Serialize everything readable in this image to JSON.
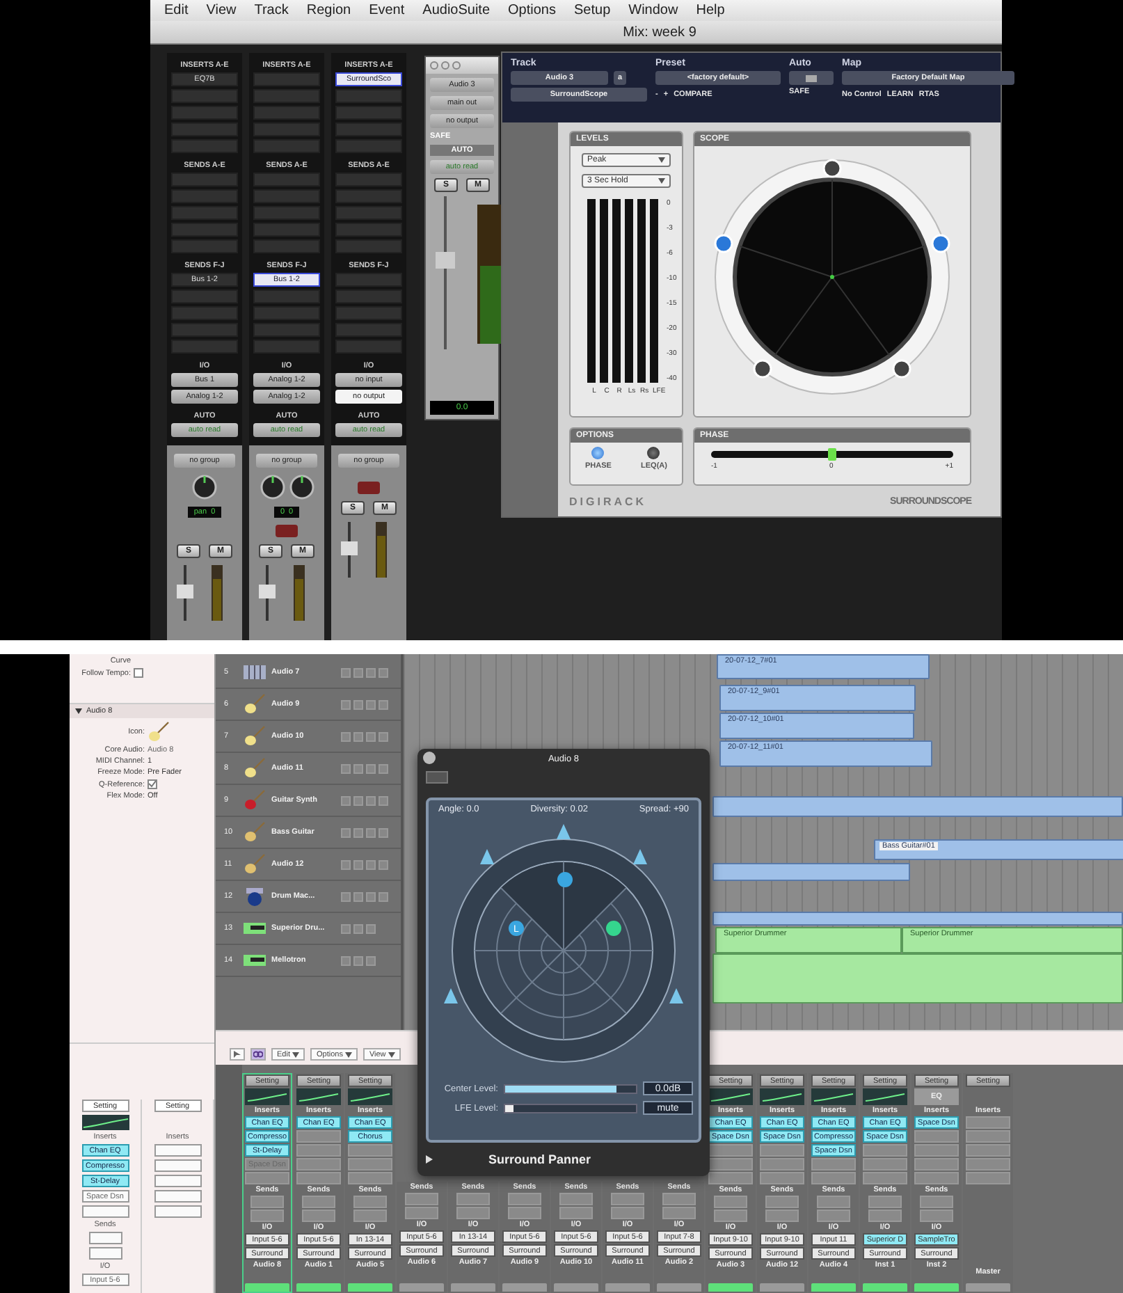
{
  "pro_tools": {
    "menu": [
      "Edit",
      "View",
      "Track",
      "Region",
      "Event",
      "AudioSuite",
      "Options",
      "Setup",
      "Window",
      "Help"
    ],
    "window_title": "Mix: week 9",
    "strips": [
      {
        "inserts_header": "INSERTS A-E",
        "inserts": [
          {
            "name": "EQ7B",
            "selected": false
          }
        ],
        "sends_header": "SENDS A-E",
        "sends_fj_header": "SENDS F-J",
        "sends_fj": [
          {
            "name": "Bus 1-2",
            "selected": false
          }
        ],
        "io_header": "I/O",
        "input": "Bus 1",
        "output": "Analog 1-2",
        "output_selected": false,
        "auto_header": "AUTO",
        "auto": "auto read",
        "group": "no group",
        "pan_label": "pan",
        "pan_readings": [
          "0"
        ],
        "record": false,
        "solo": "S",
        "mute": "M"
      },
      {
        "inserts_header": "INSERTS A-E",
        "sends_header": "SENDS A-E",
        "sends_fj_header": "SENDS F-J",
        "sends_fj": [
          {
            "name": "Bus 1-2",
            "selected": true
          }
        ],
        "io_header": "I/O",
        "input": "Analog 1-2",
        "output": "Analog 1-2",
        "output_selected": false,
        "auto_header": "AUTO",
        "auto": "auto read",
        "group": "no group",
        "pan_readings": [
          "0",
          "0"
        ],
        "record": true,
        "solo": "S",
        "mute": "M"
      },
      {
        "inserts_header": "INSERTS A-E",
        "inserts": [
          {
            "name": "SurroundSco",
            "selected": true
          }
        ],
        "sends_header": "SENDS A-E",
        "sends_fj_header": "SENDS F-J",
        "io_header": "I/O",
        "input": "no input",
        "output": "no output",
        "output_selected": true,
        "auto_header": "AUTO",
        "auto": "auto read",
        "group": "no group",
        "record": true,
        "solo": "S",
        "mute": "M"
      }
    ],
    "small_window": {
      "track": "Audio 3",
      "output": "main out",
      "output2": "no output",
      "safe": "SAFE",
      "auto_header": "AUTO",
      "auto": "auto read",
      "solo": "S",
      "mute": "M",
      "volume": "0.0"
    },
    "plugin": {
      "header": {
        "track_label": "Track",
        "preset_label": "Preset",
        "auto_label": "Auto",
        "map_label": "Map",
        "track": "Audio 3",
        "channel": "a",
        "insert": "SurroundScope",
        "preset": "<factory default>",
        "minus": "-",
        "plus": "+",
        "compare": "COMPARE",
        "safe": "SAFE",
        "map": "Factory Default Map",
        "control": "No Control",
        "learn": "LEARN",
        "format": "RTAS"
      },
      "levels": {
        "title": "LEVELS",
        "mode": "Peak",
        "hold": "3 Sec Hold",
        "scale": [
          "0",
          "-3",
          "-6",
          "-10",
          "-15",
          "-20",
          "-30",
          "-40"
        ],
        "channels": [
          "L",
          "C",
          "R",
          "Ls",
          "Rs",
          "LFE"
        ]
      },
      "scope": {
        "title": "SCOPE"
      },
      "options": {
        "title": "OPTIONS",
        "buttons": [
          {
            "label": "PHASE",
            "on": true
          },
          {
            "label": "LEQ(A)",
            "on": false
          }
        ]
      },
      "phase": {
        "title": "PHASE",
        "level": 0.5,
        "ticks": [
          "-1",
          "0",
          "+1"
        ]
      },
      "brand": "DIGIRACK",
      "logo": "SURROUNDSCOPE"
    }
  },
  "logic": {
    "inspector": {
      "curve_label": "Curve",
      "follow_tempo_label": "Follow Tempo:",
      "follow_tempo": false,
      "section": "Audio 8",
      "fields": [
        {
          "kind": "icon",
          "label": "Icon:"
        },
        {
          "kind": "text",
          "label": "Core Audio:",
          "value": "Audio 8"
        },
        {
          "kind": "menu",
          "label": "MIDI Channel:",
          "value": "1"
        },
        {
          "kind": "menu",
          "label": "Freeze Mode:",
          "value": "Pre Fader"
        },
        {
          "kind": "check",
          "label": "Q-Reference:",
          "checked": true
        },
        {
          "kind": "menu",
          "label": "Flex Mode:",
          "value": "Off"
        }
      ],
      "strips": [
        {
          "setting": "Setting",
          "eq_curve": true,
          "inserts_label": "Inserts",
          "inserts": [
            {
              "name": "Chan EQ",
              "on": true
            },
            {
              "name": "Compresso",
              "on": true
            },
            {
              "name": "St-Delay",
              "on": true
            },
            {
              "name": "Space Dsn",
              "on": false
            }
          ],
          "sends_label": "Sends",
          "io_label": "I/O",
          "input": "Input 5-6"
        },
        {
          "setting": "Setting",
          "inserts_label": "Inserts"
        }
      ]
    },
    "tracks": [
      {
        "number": "5",
        "name": "Audio 7",
        "kind": "keys"
      },
      {
        "number": "6",
        "name": "Audio 9",
        "kind": "guitar"
      },
      {
        "number": "7",
        "name": "Audio 10",
        "kind": "guitar"
      },
      {
        "number": "8",
        "name": "Audio 11",
        "kind": "guitar"
      },
      {
        "number": "9",
        "name": "Guitar Synth",
        "kind": "red_guitar"
      },
      {
        "number": "10",
        "name": "Bass Guitar",
        "kind": "bass"
      },
      {
        "number": "11",
        "name": "Audio 12",
        "kind": "bass"
      },
      {
        "number": "12",
        "name": "Drum Mac...",
        "kind": "drum"
      },
      {
        "number": "13",
        "name": "Superior Dru...",
        "kind": "instrument"
      },
      {
        "number": "14",
        "name": "Mellotron",
        "kind": "instrument"
      }
    ],
    "regions": [
      {
        "kind": "audio",
        "label": "20-07-12_7#01"
      },
      {
        "kind": "audio",
        "label": "20-07-12_9#01"
      },
      {
        "kind": "audio",
        "label": "20-07-12_10#01"
      },
      {
        "kind": "audio",
        "label": "20-07-12_11#01"
      },
      {
        "kind": "audio"
      },
      {
        "kind": "audio",
        "label": "Bass Guitar#01"
      },
      {
        "kind": "audio"
      },
      {
        "kind": "audio"
      },
      {
        "kind": "midi",
        "label": "Superior Drummer"
      },
      {
        "kind": "midi",
        "label": "Superior Drummer"
      },
      {
        "kind": "midi"
      }
    ],
    "toolbar": [
      "Edit",
      "Options",
      "View"
    ],
    "mixer": [
      {
        "setting": "Setting",
        "eq_curve": true,
        "inserts_label": "Inserts",
        "inserts": [
          {
            "name": "Chan EQ",
            "on": true
          },
          {
            "name": "Compresso",
            "on": true
          },
          {
            "name": "St-Delay",
            "on": true
          },
          {
            "name": "Space Dsn",
            "on": false
          }
        ],
        "sends_label": "Sends",
        "io_label": "I/O",
        "input": "Input 5-6",
        "output": "Surround",
        "name": "Audio 8",
        "selected": true,
        "read": true
      },
      {
        "setting": "Setting",
        "eq_curve": true,
        "inserts_label": "Inserts",
        "inserts": [
          {
            "name": "Chan EQ",
            "on": true
          }
        ],
        "sends_label": "Sends",
        "io_label": "I/O",
        "input": "Input 5-6",
        "output": "Surround",
        "name": "Audio 1",
        "selected": false,
        "read": true
      },
      {
        "setting": "Setting",
        "eq_curve": true,
        "inserts_label": "Inserts",
        "inserts": [
          {
            "name": "Chan EQ",
            "on": true
          },
          {
            "name": "Chorus",
            "on": true
          }
        ],
        "sends_label": "Sends",
        "io_label": "I/O",
        "input": "In 13-14",
        "output": "Surround",
        "name": "Audio 5",
        "selected": false,
        "read": true
      },
      {
        "sends_label": "Sends",
        "io_label": "I/O",
        "input": "Input 5-6",
        "output": "Surround",
        "name": "Audio 6",
        "selected": false,
        "read": false
      },
      {
        "sends_label": "Sends",
        "io_label": "I/O",
        "input": "In 13-14",
        "output": "Surround",
        "name": "Audio 7",
        "selected": false,
        "read": false
      },
      {
        "sends_label": "Sends",
        "io_label": "I/O",
        "input": "Input 5-6",
        "output": "Surround",
        "name": "Audio 9",
        "selected": false,
        "read": false
      },
      {
        "sends_label": "Sends",
        "io_label": "I/O",
        "input": "Input 5-6",
        "output": "Surround",
        "name": "Audio 10",
        "selected": false,
        "read": false
      },
      {
        "sends_label": "Sends",
        "io_label": "I/O",
        "input": "Input 5-6",
        "output": "Surround",
        "name": "Audio 11",
        "selected": false,
        "read": false
      },
      {
        "sends_label": "Sends",
        "io_label": "I/O",
        "input": "Input 7-8",
        "output": "Surround",
        "name": "Audio 2",
        "selected": false,
        "read": false
      },
      {
        "setting": "Setting",
        "eq_curve": true,
        "inserts_label": "Inserts",
        "inserts": [
          {
            "name": "Chan EQ",
            "on": true
          },
          {
            "name": "Space Dsn",
            "on": true
          }
        ],
        "sends_label": "Sends",
        "io_label": "I/O",
        "input": "Input 9-10",
        "output": "Surround",
        "name": "Audio 3",
        "selected": false,
        "read": true
      },
      {
        "setting": "Setting",
        "eq_curve": true,
        "inserts_label": "Inserts",
        "inserts": [
          {
            "name": "Chan EQ",
            "on": true
          },
          {
            "name": "Space Dsn",
            "on": true
          }
        ],
        "sends_label": "Sends",
        "io_label": "I/O",
        "input": "Input 9-10",
        "output": "Surround",
        "name": "Audio 12",
        "selected": false,
        "read": false
      },
      {
        "setting": "Setting",
        "eq_curve": true,
        "inserts_label": "Inserts",
        "inserts": [
          {
            "name": "Chan EQ",
            "on": true
          },
          {
            "name": "Compresso",
            "on": true
          },
          {
            "name": "Space Dsn",
            "on": true
          }
        ],
        "sends_label": "Sends",
        "io_label": "I/O",
        "input": "Input 11",
        "output": "Surround",
        "name": "Audio 4",
        "selected": false,
        "read": true
      },
      {
        "setting": "Setting",
        "eq_curve": true,
        "inserts_label": "Inserts",
        "inserts": [
          {
            "name": "Chan EQ",
            "on": true
          },
          {
            "name": "Space Dsn",
            "on": true
          }
        ],
        "sends_label": "Sends",
        "io_label": "I/O",
        "input": "Superior D",
        "input_plugin": true,
        "output": "Surround",
        "name": "Inst 1",
        "selected": false,
        "read": true
      },
      {
        "setting": "Setting",
        "eq_label": "EQ",
        "inserts_label": "Inserts",
        "inserts": [
          {
            "name": "Space Dsn",
            "on": true
          }
        ],
        "sends_label": "Sends",
        "io_label": "I/O",
        "input": "SampleTro",
        "input_plugin": true,
        "output": "Surround",
        "name": "Inst 2",
        "selected": false,
        "read": true
      },
      {
        "setting": "Setting",
        "inserts_label": "Inserts",
        "name": "Master",
        "selected": false,
        "read": false
      }
    ],
    "panner": {
      "title": "Audio 8",
      "angle_label": "Angle:",
      "angle": "0.0",
      "diversity_label": "Diversity:",
      "diversity": "0.02",
      "spread_label": "Spread:",
      "spread": "+90",
      "sources": [
        {
          "label": "L",
          "color": "#3aa6e0"
        },
        {
          "color": "#3aa6e0"
        },
        {
          "color": "#35d58e"
        }
      ],
      "center": {
        "label": "Center Level:",
        "level": 0.85,
        "value": "0.0dB"
      },
      "lfe": {
        "label": "LFE Level:",
        "level": 0.06,
        "value": "mute"
      },
      "footer": "Surround Panner"
    }
  }
}
